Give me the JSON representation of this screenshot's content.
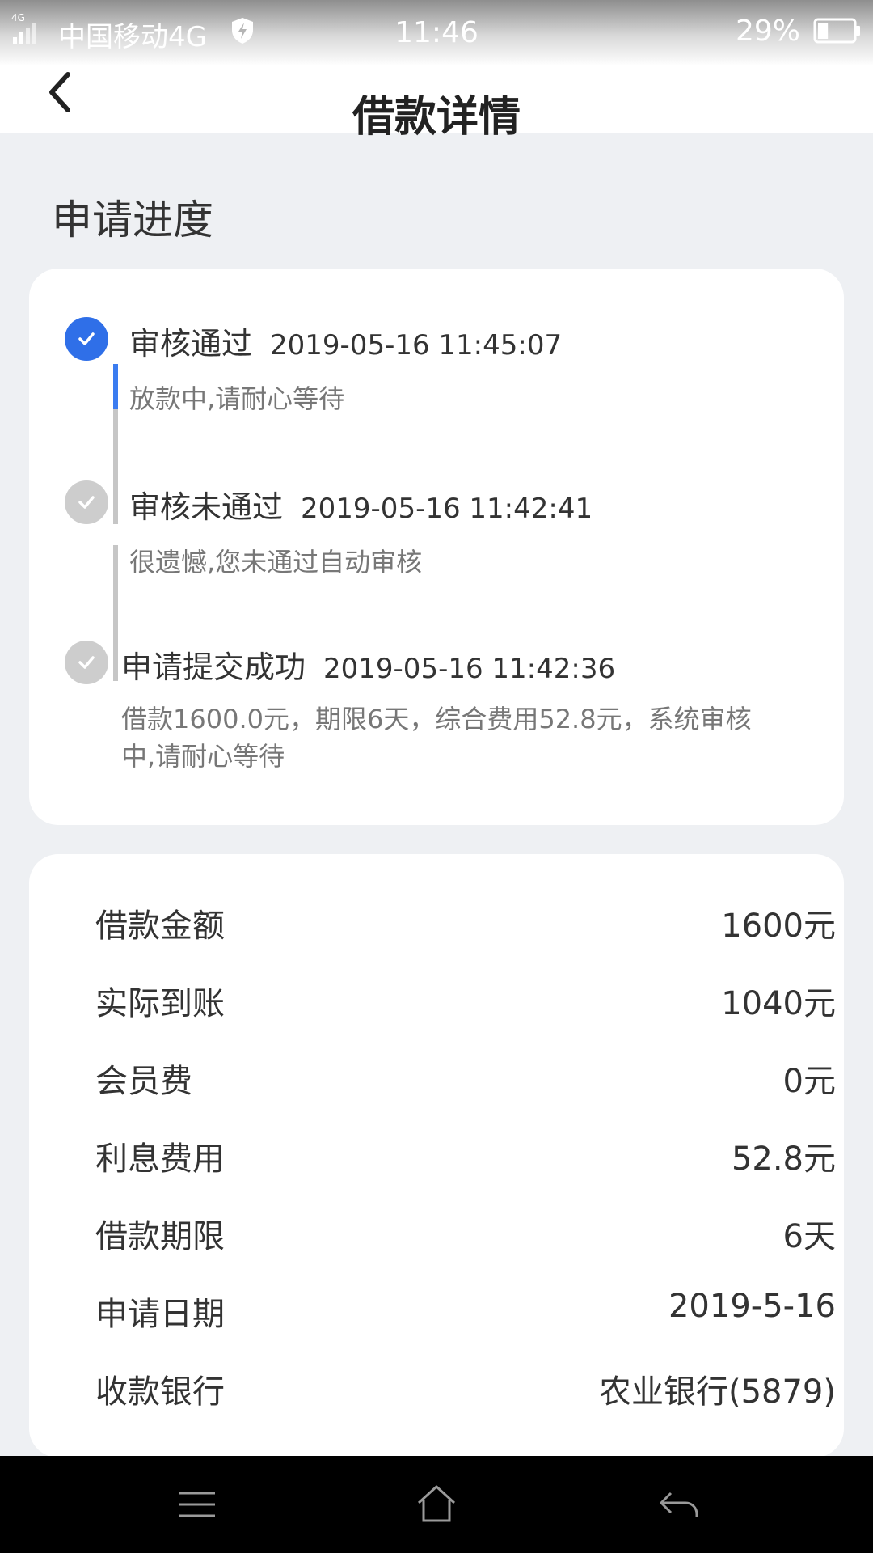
{
  "status_bar": {
    "carrier": "中国移动4G",
    "network_badge": "4G",
    "time": "11:46",
    "battery_percent": "29%",
    "battery_level": 0.29
  },
  "header": {
    "title": "借款详情",
    "back_icon": "chevron-left-icon"
  },
  "progress": {
    "section_title": "申请进度",
    "steps": [
      {
        "status": "审核通过",
        "timestamp": "2019-05-16 11:45:07",
        "description": "放款中,请耐心等待",
        "state": "active"
      },
      {
        "status": "审核未通过",
        "timestamp": "2019-05-16 11:42:41",
        "description": "很遗憾,您未通过自动审核",
        "state": "inactive"
      },
      {
        "status": "申请提交成功",
        "timestamp": "2019-05-16 11:42:36",
        "description_line1": "借款1600.0元，期限6天，综合费用52.8元，系统审核",
        "description_line2": "中,请耐心等待",
        "state": "inactive"
      }
    ]
  },
  "details": [
    {
      "label": "借款金额",
      "value": "1600元"
    },
    {
      "label": "实际到账",
      "value": "1040元"
    },
    {
      "label": "会员费",
      "value": "0元"
    },
    {
      "label": "利息费用",
      "value": "52.8元"
    },
    {
      "label": "借款期限",
      "value": "6天"
    },
    {
      "label": "申请日期",
      "value": "2019-5-16"
    },
    {
      "label": "收款银行",
      "value": "农业银行(5879)"
    }
  ],
  "colors": {
    "accent": "#2f6fe8",
    "inactive": "#cdcdcd",
    "background": "#eef0f3"
  },
  "bottom_nav": {
    "icons": [
      "menu-icon",
      "home-icon",
      "back-arrow-icon"
    ]
  }
}
